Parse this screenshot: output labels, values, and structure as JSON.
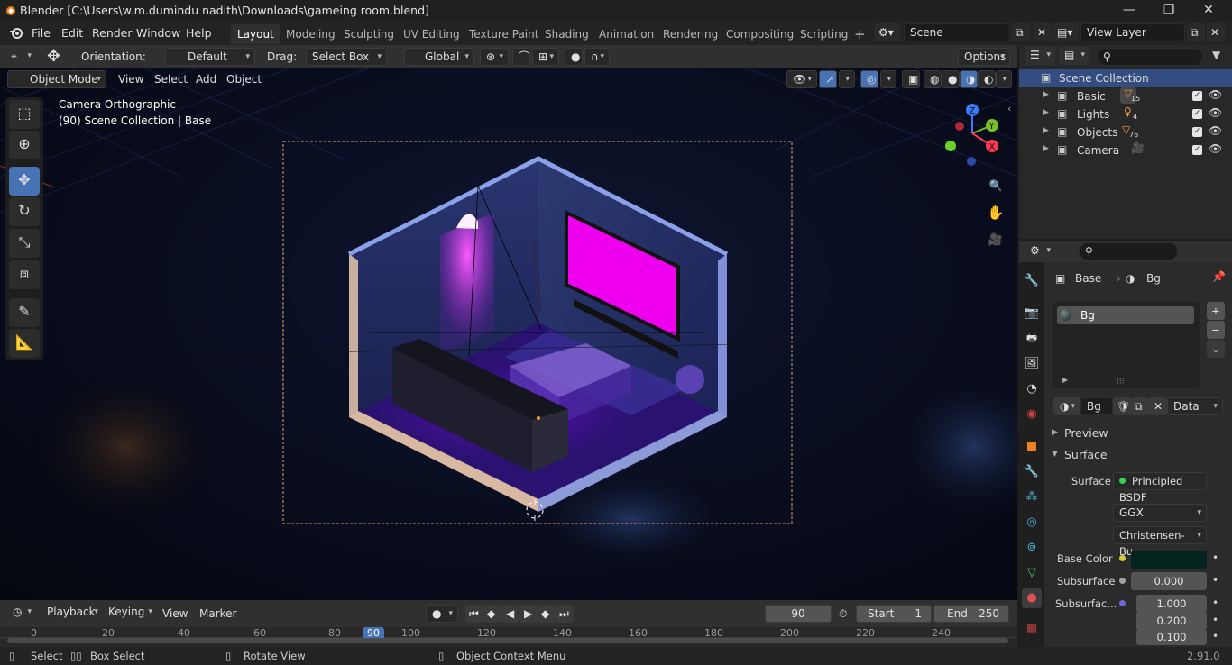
{
  "window": {
    "title": "Blender [C:\\Users\\w.m.dumindu nadith\\Downloads\\gameing room.blend]"
  },
  "menu": {
    "items": [
      "File",
      "Edit",
      "Render",
      "Window",
      "Help"
    ]
  },
  "workspaces": [
    "Layout",
    "Modeling",
    "Sculpting",
    "UV Editing",
    "Texture Paint",
    "Shading",
    "Animation",
    "Rendering",
    "Compositing",
    "Scripting"
  ],
  "scene": {
    "name": "Scene",
    "view_layer": "View Layer"
  },
  "tool_header": {
    "orientation_label": "Orientation:",
    "orientation_value": "Default",
    "drag_label": "Drag:",
    "drag_value": "Select Box",
    "transform_value": "Global",
    "options_label": "Options"
  },
  "view_header": {
    "mode": "Object Mode",
    "menus": [
      "View",
      "Select",
      "Add",
      "Object"
    ]
  },
  "viewport": {
    "camera_label": "Camera Orthographic",
    "collection_label": "(90) Scene Collection | Base"
  },
  "outliner": {
    "root": "Scene Collection",
    "items": [
      {
        "name": "Basic",
        "count": "15"
      },
      {
        "name": "Lights",
        "count": "4"
      },
      {
        "name": "Objects",
        "count": "76"
      },
      {
        "name": "Camera",
        "count": ""
      }
    ]
  },
  "properties": {
    "breadcrumb_object": "Base",
    "breadcrumb_material": "Bg",
    "slot_name": "Bg",
    "material_name": "Bg",
    "data_dropdown": "Data",
    "preview_label": "Preview",
    "surface_panel": "Surface",
    "surface_label": "Surface",
    "surface_value": "Principled BSDF",
    "distribution": "GGX",
    "subsurface_method": "Christensen-Bu...",
    "base_color_label": "Base Color",
    "base_color": "#05231e",
    "subsurface_label": "Subsurface",
    "subsurface_value": "0.000",
    "subsurface_radius_label": "Subsurfac...",
    "radius": [
      "1.000",
      "0.200",
      "0.100"
    ]
  },
  "timeline": {
    "menus": [
      "Playback",
      "Keying",
      "View",
      "Marker"
    ],
    "current_frame": "90",
    "start_label": "Start",
    "start": "1",
    "end_label": "End",
    "end": "250",
    "ticks": [
      "0",
      "20",
      "40",
      "60",
      "80",
      "90",
      "100",
      "120",
      "140",
      "160",
      "180",
      "200",
      "220",
      "240"
    ]
  },
  "statusbar": {
    "select": "Select",
    "box_select": "Box Select",
    "rotate": "Rotate View",
    "context": "Object Context Menu",
    "version": "2.91.0"
  },
  "colors": {
    "accent": "#4772b3",
    "header": "#303030",
    "panel": "#2b2b2b",
    "tv_screen": "#ee00ee",
    "room_glow": "#6b12d6"
  }
}
